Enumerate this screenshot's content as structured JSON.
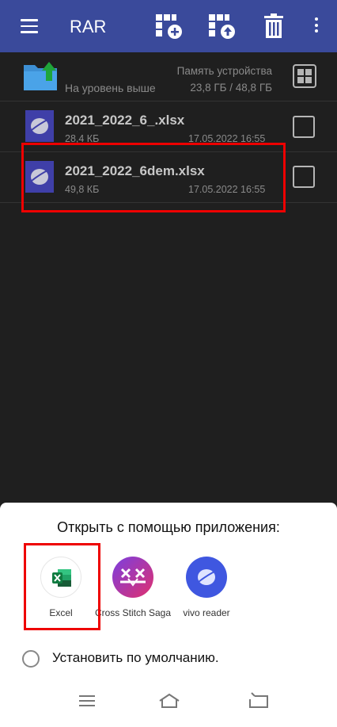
{
  "toolbar": {
    "title": "RAR",
    "icons": [
      "menu-icon",
      "add-to-archive-icon",
      "extract-icon",
      "trash-icon",
      "more-vertical-icon"
    ]
  },
  "up_row": {
    "label": "На уровень выше",
    "storage_label": "Память устройства",
    "storage_usage": "23,8 ГБ / 48,8 ГБ"
  },
  "files": [
    {
      "name": "2021_2022_6_.xlsx",
      "size": "28,4 КБ",
      "date": "17.05.2022 16:55"
    },
    {
      "name": "2021_2022_6dem.xlsx",
      "size": "49,8 КБ",
      "date": "17.05.2022 16:55"
    }
  ],
  "sheet": {
    "title": "Открыть с помощью приложения:",
    "apps": [
      {
        "label": "Excel",
        "icon": "excel-icon"
      },
      {
        "label": "Cross Stitch Saga",
        "icon": "cross-stitch-saga-icon"
      },
      {
        "label": "vivo reader",
        "icon": "vivo-reader-icon"
      }
    ],
    "default_label": "Установить по умолчанию."
  },
  "nav": [
    "menu-nav-icon",
    "home-nav-icon",
    "back-nav-icon"
  ],
  "colors": {
    "toolbar_bg": "#3a4a9b",
    "list_bg": "#1f1f1f",
    "highlight": "#e00000",
    "excel_green": "#1d7044",
    "vivo_blue": "#3f57e0"
  }
}
